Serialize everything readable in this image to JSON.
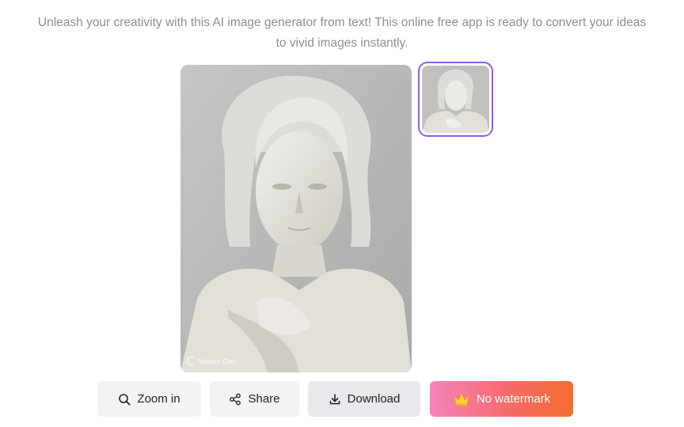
{
  "description": "Unleash your creativity with this AI image generator from text! This online free app is ready to convert your ideas to vivid images instantly.",
  "main_image": {
    "alt": "Generated marble statue portrait",
    "watermark": "Vidnoz Gen"
  },
  "thumbnails": [
    {
      "selected": true
    }
  ],
  "actions": {
    "zoom_label": "Zoom in",
    "share_label": "Share",
    "download_label": "Download",
    "premium_label": "No watermark"
  },
  "icons": {
    "zoom": "magnifier-icon",
    "share": "share-icon",
    "download": "download-icon",
    "premium": "crown-icon"
  },
  "colors": {
    "description_text": "#8a8f99",
    "thumbnail_border": "#8b5cf6",
    "button_bg": "#f2f3f5",
    "premium_gradient_start": "#f683bd",
    "premium_gradient_end": "#f36d2d"
  }
}
